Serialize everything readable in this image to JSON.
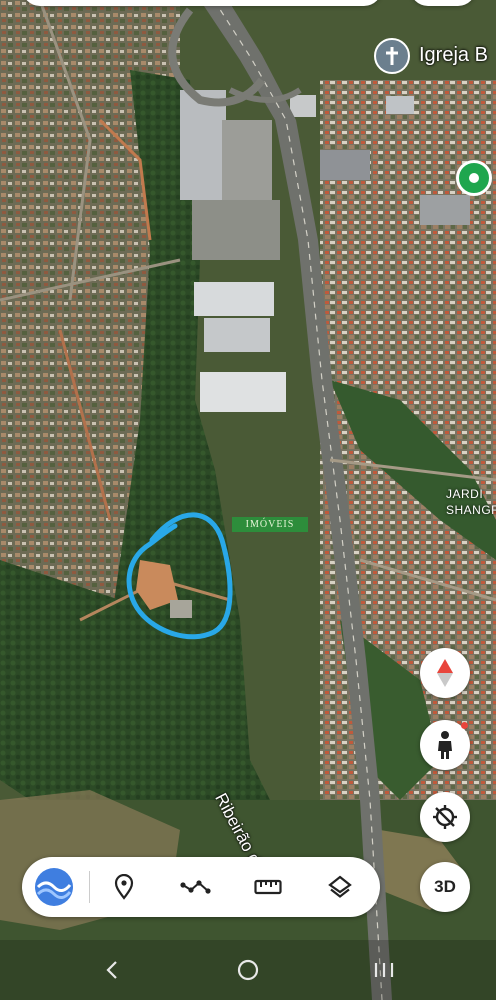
{
  "map": {
    "place_label": "Igreja B",
    "area_label_line1": "JARDI",
    "area_label_line2": "SHANGR",
    "river_label": "Ribeirão do O",
    "watermark_text": "IMÓVEIS",
    "highlight_color": "#29a8e8",
    "place_pin_icon": "church-cross-icon",
    "saved_place_icon": "green-location-pin-icon"
  },
  "controls": {
    "compass_icon": "compass-icon",
    "street_view_icon": "pegman-icon",
    "locate_icon": "location-off-icon",
    "three_d_label": "3D"
  },
  "toolbar": {
    "items": [
      "earth-icon",
      "place-pin-icon",
      "draw-line-icon",
      "measure-ruler-icon",
      "layers-icon"
    ]
  },
  "navbar": {
    "items": [
      "back-icon",
      "home-icon",
      "recents-icon"
    ]
  }
}
